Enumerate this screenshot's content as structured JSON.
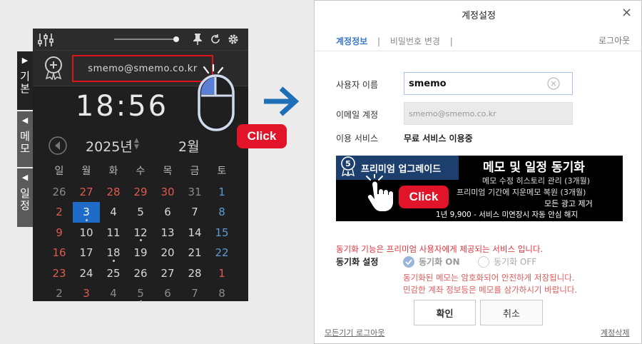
{
  "widget": {
    "email": "smemo@smemo.co.kr",
    "time": "18:56",
    "year": "2025년",
    "month": "2월",
    "side_tabs": [
      "기본",
      "메모",
      "일정"
    ],
    "weekdays": [
      "일",
      "월",
      "화",
      "수",
      "목",
      "금",
      "토"
    ],
    "weeks": [
      [
        "26",
        "27",
        "28",
        "29",
        "30",
        "31",
        "1"
      ],
      [
        "2",
        "3",
        "4",
        "5",
        "6",
        "7",
        "8"
      ],
      [
        "9",
        "10",
        "11",
        "12",
        "13",
        "14",
        "15"
      ],
      [
        "16",
        "17",
        "18",
        "19",
        "20",
        "21",
        "22"
      ],
      [
        "23",
        "24",
        "25",
        "26",
        "27",
        "28",
        "1"
      ],
      [
        "2",
        "3",
        "4",
        "5",
        "6",
        "7",
        "8"
      ]
    ],
    "click_label": "Click"
  },
  "dialog": {
    "title": "계정설정",
    "close": "×",
    "tab_account": "계정정보",
    "tab_sep1": "|",
    "tab_password": "비밀번호 변경",
    "tab_sep2": "|",
    "logout": "로그아웃",
    "username_label": "사용자 이름",
    "username_value": "smemo",
    "email_label": "이메일 계정",
    "email_value": "smemo@smemo.co.kr",
    "service_label": "이용 서비스",
    "service_value": "무료 서비스 이용중",
    "banner": {
      "upgrade": "프리미엄 업그레이드",
      "headline": "메모 및 일정 동기화",
      "line1": "메모 수정 히스토리 관리 (3개월)",
      "line2": "프리미엄 기간에 지운메모 복원 (3개월)",
      "line3": "모든 광고 제거",
      "line4": "1년 9,900 - 서비스 미연장시 자동 안심 해지",
      "click_label": "Click"
    },
    "sync_notice": "동기화 기능은 프리미엄 사용자에게 제공되는 서비스 입니다.",
    "sync_label": "동기화 설정",
    "sync_on": "동기화 ON",
    "sync_off": "동기화 OFF",
    "sync_note1": "동기화된 메모는 암호화되어 안전하게 저장됩니다.",
    "sync_note2": "민감한 계좌 정보등은 메모를 삼가하시기 바랍니다.",
    "confirm": "확인",
    "cancel": "취소",
    "logout_all": "모든기기 로그아웃",
    "delete_account": "계정삭제"
  }
}
